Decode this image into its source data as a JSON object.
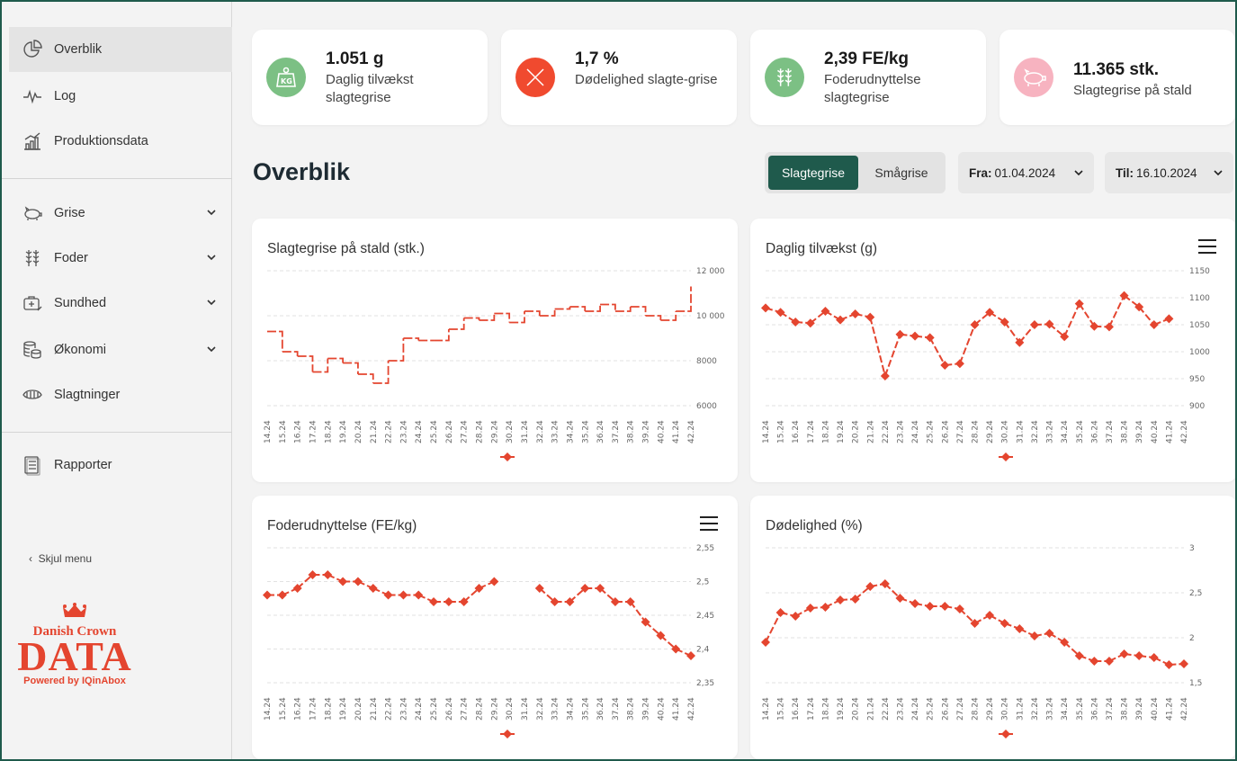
{
  "sidebar": {
    "items": [
      {
        "label": "Overblik"
      },
      {
        "label": "Log"
      },
      {
        "label": "Produktionsdata"
      },
      {
        "label": "Grise"
      },
      {
        "label": "Foder"
      },
      {
        "label": "Sundhed"
      },
      {
        "label": "Økonomi"
      },
      {
        "label": "Slagtninger"
      },
      {
        "label": "Rapporter"
      }
    ],
    "hide_menu": "Skjul menu",
    "logo": {
      "brand": "Danish Crown",
      "word": "DATA",
      "powered": "Powered by IQinAbox"
    }
  },
  "kpis": [
    {
      "value": "1.051 g",
      "label": "Daglig tilvækst slagtegrise",
      "icon": "kg-weight-icon",
      "color": "#7cc084"
    },
    {
      "value": "1,7 %",
      "label": "Dødelighed slagte-grise",
      "icon": "x-icon",
      "color": "#f04a2f"
    },
    {
      "value": "2,39 FE/kg",
      "label": "Foderudnyttelse slagtegrise",
      "icon": "grain-icon",
      "color": "#7cc084"
    },
    {
      "value": "11.365 stk.",
      "label": "Slagtegrise på stald",
      "icon": "pig-icon",
      "color": "#f7b3c0"
    }
  ],
  "header": {
    "title": "Overblik",
    "toggle": [
      "Slagtegrise",
      "Smågrise"
    ],
    "from_label": "Fra:",
    "from_value": "01.04.2024",
    "to_label": "Til:",
    "to_value": "16.10.2024"
  },
  "colors": {
    "accent": "#1f5a4c",
    "series": "#e4452f"
  },
  "chart_data": [
    {
      "type": "line",
      "title": "Slagtegrise på stald (stk.)",
      "style": "step",
      "x": [
        "14.24",
        "15.24",
        "16.24",
        "17.24",
        "18.24",
        "19.24",
        "20.24",
        "21.24",
        "22.24",
        "23.24",
        "24.24",
        "25.24",
        "26.24",
        "27.24",
        "28.24",
        "29.24",
        "30.24",
        "31.24",
        "32.24",
        "33.24",
        "34.24",
        "35.24",
        "36.24",
        "37.24",
        "38.24",
        "39.24",
        "40.24",
        "41.24",
        "42.24"
      ],
      "values": [
        9300,
        8400,
        8200,
        7500,
        8100,
        7900,
        7400,
        7000,
        8000,
        9000,
        8900,
        8900,
        9400,
        9900,
        9800,
        10100,
        9700,
        10200,
        10000,
        10300,
        10400,
        10200,
        10500,
        10200,
        10400,
        10000,
        9800,
        10200,
        11300
      ],
      "yticks": [
        "12 000",
        "10 000",
        "8000",
        "6000"
      ],
      "ylim": [
        6000,
        12000
      ]
    },
    {
      "type": "line",
      "title": "Daglig tilvækst (g)",
      "x": [
        "14.24",
        "15.24",
        "16.24",
        "17.24",
        "18.24",
        "19.24",
        "20.24",
        "21.24",
        "22.24",
        "23.24",
        "24.24",
        "25.24",
        "26.24",
        "27.24",
        "28.24",
        "29.24",
        "30.24",
        "31.24",
        "32.24",
        "33.24",
        "34.24",
        "35.24",
        "36.24",
        "37.24",
        "38.24",
        "39.24",
        "40.24",
        "41.24",
        "42.24"
      ],
      "values": [
        1081,
        1073,
        1055,
        1053,
        1075,
        1059,
        1070,
        1064,
        955,
        1032,
        1029,
        1026,
        975,
        978,
        1050,
        1073,
        1055,
        1017,
        1050,
        1051,
        1028,
        1089,
        1047,
        1046,
        1104,
        1083,
        1050,
        1061,
        null
      ],
      "yticks": [
        "1150",
        "1100",
        "1050",
        "1000",
        "950",
        "900"
      ],
      "ylim": [
        900,
        1150
      ]
    },
    {
      "type": "line",
      "title": "Foderudnyttelse (FE/kg)",
      "x": [
        "14.24",
        "15.24",
        "16.24",
        "17.24",
        "18.24",
        "19.24",
        "20.24",
        "21.24",
        "22.24",
        "23.24",
        "24.24",
        "25.24",
        "26.24",
        "27.24",
        "28.24",
        "29.24",
        "30.24",
        "31.24",
        "32.24",
        "33.24",
        "34.24",
        "35.24",
        "36.24",
        "37.24",
        "38.24",
        "39.24",
        "40.24",
        "41.24",
        "42.24"
      ],
      "values": [
        2.48,
        2.48,
        2.49,
        2.51,
        2.51,
        2.5,
        2.5,
        2.49,
        2.48,
        2.48,
        2.48,
        2.47,
        2.47,
        2.47,
        2.49,
        2.5,
        null,
        null,
        2.49,
        2.47,
        2.47,
        2.49,
        2.49,
        2.47,
        2.47,
        2.44,
        2.42,
        2.4,
        2.39
      ],
      "yticks": [
        "2,55",
        "2,5",
        "2,45",
        "2,4",
        "2,35"
      ],
      "ylim": [
        2.35,
        2.55
      ]
    },
    {
      "type": "line",
      "title": "Dødelighed (%)",
      "x": [
        "14.24",
        "15.24",
        "16.24",
        "17.24",
        "18.24",
        "19.24",
        "20.24",
        "21.24",
        "22.24",
        "23.24",
        "24.24",
        "25.24",
        "26.24",
        "27.24",
        "28.24",
        "29.24",
        "30.24",
        "31.24",
        "32.24",
        "33.24",
        "34.24",
        "35.24",
        "36.24",
        "37.24",
        "38.24",
        "39.24",
        "40.24",
        "41.24",
        "42.24"
      ],
      "values": [
        1.95,
        2.28,
        2.24,
        2.33,
        2.34,
        2.42,
        2.43,
        2.57,
        2.6,
        2.44,
        2.38,
        2.35,
        2.35,
        2.32,
        2.16,
        2.25,
        2.16,
        2.1,
        2.02,
        2.05,
        1.95,
        1.8,
        1.74,
        1.74,
        1.82,
        1.8,
        1.78,
        1.7,
        1.71
      ],
      "yticks": [
        "3",
        "2,5",
        "2",
        "1,5"
      ],
      "ylim": [
        1.5,
        3.0
      ]
    }
  ]
}
